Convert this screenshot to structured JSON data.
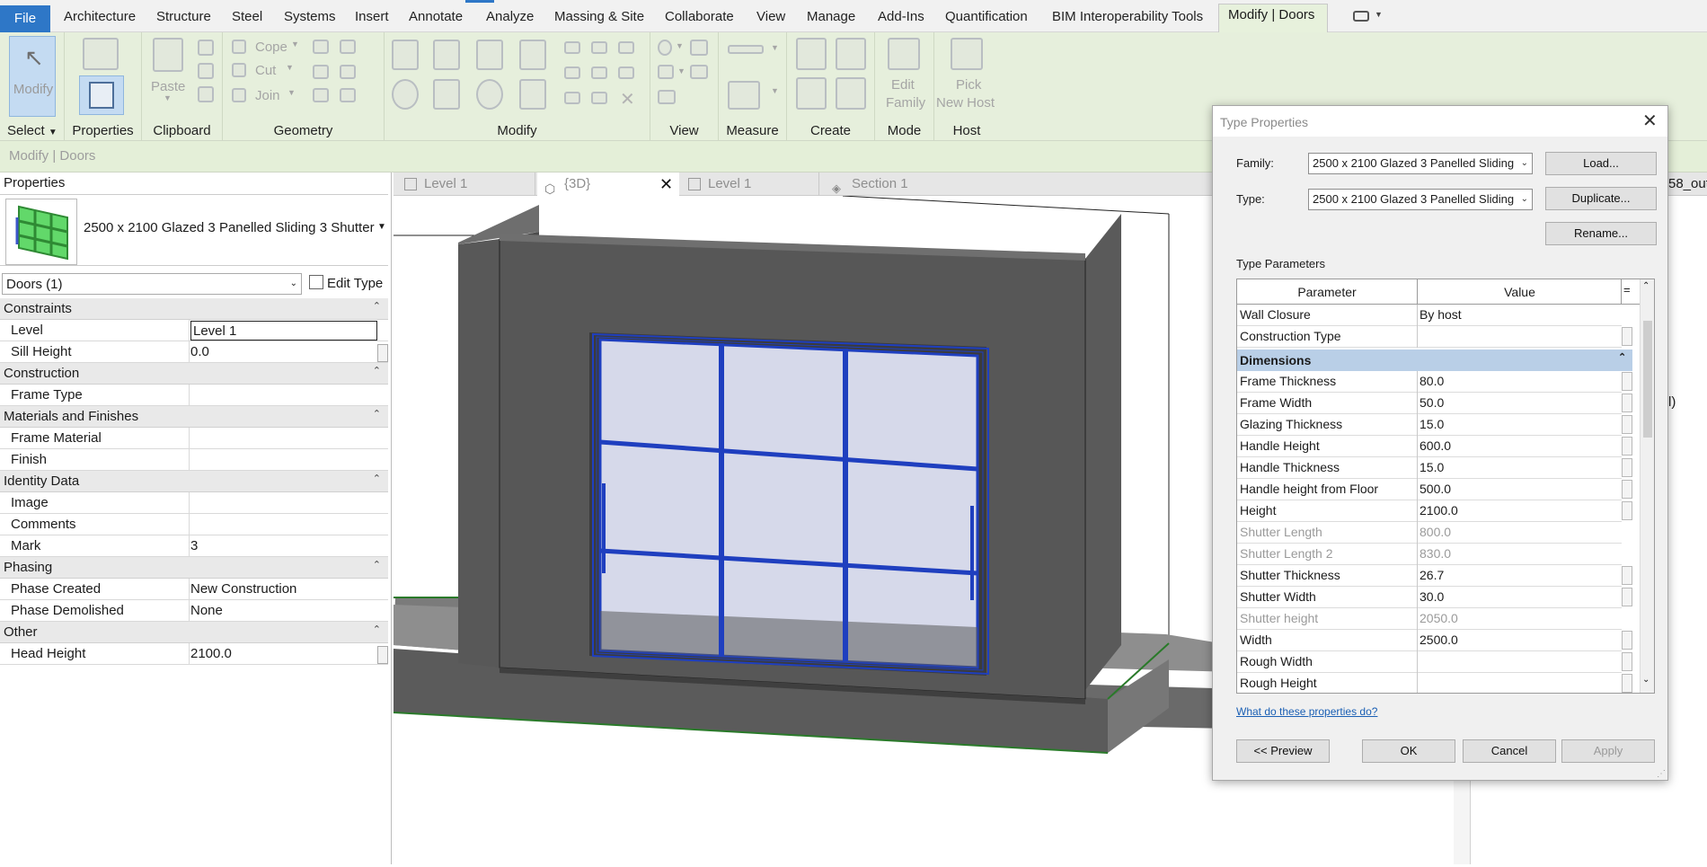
{
  "ribbon": {
    "tabs": [
      "File",
      "Architecture",
      "Structure",
      "Steel",
      "Systems",
      "Insert",
      "Annotate",
      "Analyze",
      "Massing & Site",
      "Collaborate",
      "View",
      "Manage",
      "Add-Ins",
      "Quantification",
      "BIM Interoperability Tools",
      "Modify | Doors"
    ],
    "tools": {
      "modify": "Modify",
      "paste": "Paste",
      "cope": "Cope",
      "cut": "Cut",
      "join": "Join",
      "edit_family": [
        "Edit",
        "Family"
      ],
      "pick_new_host": [
        "Pick",
        "New Host"
      ]
    },
    "panels": [
      "Select",
      "Properties",
      "Clipboard",
      "Geometry",
      "Modify",
      "View",
      "Measure",
      "Create",
      "Mode",
      "Host"
    ],
    "context_label": "Modify | Doors"
  },
  "properties": {
    "header": "Properties",
    "type_name": "2500 x 2100 Glazed 3 Panelled Sliding 3 Shutter",
    "selector": "Doors (1)",
    "edit_type": "Edit Type",
    "sections": [
      {
        "name": "Constraints",
        "rows": [
          {
            "k": "Level",
            "v": "Level 1"
          },
          {
            "k": "Sill Height",
            "v": "0.0"
          }
        ]
      },
      {
        "name": "Construction",
        "rows": [
          {
            "k": "Frame Type",
            "v": ""
          }
        ]
      },
      {
        "name": "Materials and Finishes",
        "rows": [
          {
            "k": "Frame Material",
            "v": ""
          },
          {
            "k": "Finish",
            "v": ""
          }
        ]
      },
      {
        "name": "Identity Data",
        "rows": [
          {
            "k": "Image",
            "v": ""
          },
          {
            "k": "Comments",
            "v": ""
          },
          {
            "k": "Mark",
            "v": "3"
          }
        ]
      },
      {
        "name": "Phasing",
        "rows": [
          {
            "k": "Phase Created",
            "v": "New Construction"
          },
          {
            "k": "Phase Demolished",
            "v": "None"
          }
        ]
      },
      {
        "name": "Other",
        "rows": [
          {
            "k": "Head Height",
            "v": "2100.0"
          }
        ]
      }
    ]
  },
  "view_tabs": [
    "Level 1",
    "{3D}",
    "Level 1",
    "Section 1"
  ],
  "background_fragments": [
    "58_out",
    "l)"
  ],
  "dialog": {
    "title": "Type Properties",
    "family_label": "Family:",
    "family_value": "2500 x 2100 Glazed 3 Panelled Sliding",
    "type_label": "Type:",
    "type_value": "2500 x 2100 Glazed 3 Panelled Sliding",
    "load": "Load...",
    "duplicate": "Duplicate...",
    "rename": "Rename...",
    "type_parameters": "Type Parameters",
    "col_parameter": "Parameter",
    "col_value": "Value",
    "col_eq": "=",
    "rows_top": [
      {
        "k": "Wall Closure",
        "v": "By host"
      },
      {
        "k": "Construction Type",
        "v": ""
      }
    ],
    "group": "Dimensions",
    "rows": [
      {
        "k": "Frame Thickness",
        "v": "80.0",
        "dim": false
      },
      {
        "k": "Frame Width",
        "v": "50.0",
        "dim": false
      },
      {
        "k": "Glazing Thickness",
        "v": "15.0",
        "dim": false
      },
      {
        "k": "Handle Height",
        "v": "600.0",
        "dim": false
      },
      {
        "k": "Handle Thickness",
        "v": "15.0",
        "dim": false
      },
      {
        "k": "Handle height from Floor",
        "v": "500.0",
        "dim": false
      },
      {
        "k": "Height",
        "v": "2100.0",
        "dim": false
      },
      {
        "k": "Shutter Length",
        "v": "800.0",
        "dim": true
      },
      {
        "k": "Shutter Length 2",
        "v": "830.0",
        "dim": true
      },
      {
        "k": "Shutter Thickness",
        "v": "26.7",
        "dim": false
      },
      {
        "k": "Shutter Width",
        "v": "30.0",
        "dim": false
      },
      {
        "k": "Shutter height",
        "v": "2050.0",
        "dim": true
      },
      {
        "k": "Width",
        "v": "2500.0",
        "dim": false
      },
      {
        "k": "Rough Width",
        "v": "",
        "dim": false
      },
      {
        "k": "Rough Height",
        "v": "",
        "dim": false
      }
    ],
    "help_link": "What do these properties do?",
    "preview": "<< Preview",
    "ok": "OK",
    "cancel": "Cancel",
    "apply": "Apply"
  }
}
